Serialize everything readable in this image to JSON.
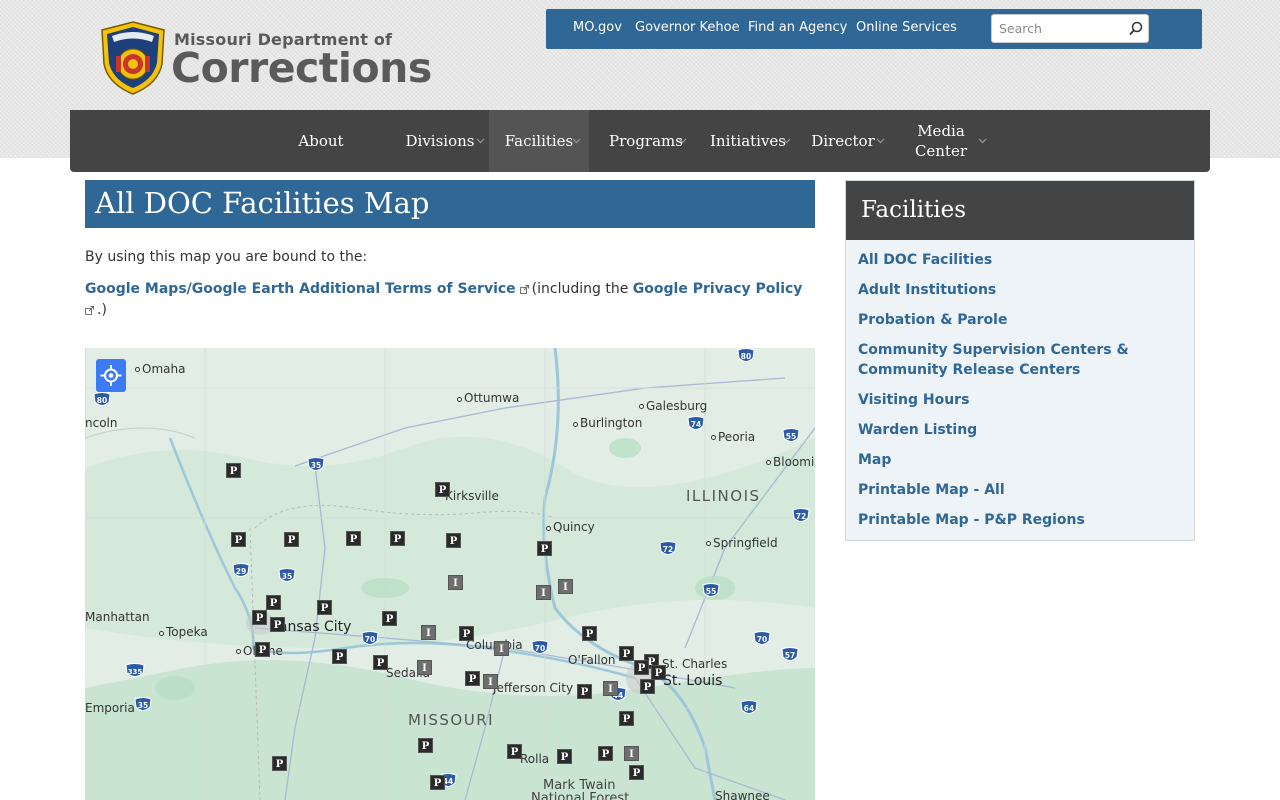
{
  "header": {
    "logo_line1": "Missouri Department of",
    "logo_line2": "Corrections"
  },
  "utility_nav": {
    "links": [
      "MO.gov",
      "Governor Kehoe",
      "Find an Agency",
      "Online Services"
    ],
    "search_placeholder": "Search"
  },
  "main_nav": {
    "items": [
      {
        "label": "About",
        "has_dropdown": false,
        "active": false
      },
      {
        "label": "Divisions",
        "has_dropdown": true,
        "active": false
      },
      {
        "label": "Facilities",
        "has_dropdown": true,
        "active": true
      },
      {
        "label": "Programs",
        "has_dropdown": true,
        "active": false
      },
      {
        "label": "Initiatives",
        "has_dropdown": true,
        "active": false
      },
      {
        "label": "Director",
        "has_dropdown": true,
        "active": false
      },
      {
        "label": "Media Center",
        "has_dropdown": true,
        "active": false
      }
    ]
  },
  "content": {
    "title": "All DOC Facilities Map",
    "intro": "By using this map you are bound to the:",
    "terms_link": "Google Maps/Google Earth Additional Terms of Service",
    "terms_mid": "(including the",
    "privacy_link": "Google Privacy Policy",
    "terms_end": ".)"
  },
  "map": {
    "cities": [
      "Omaha",
      "Ottumwa",
      "Galesburg",
      "Burlington",
      "Peoria",
      "Bloomin",
      "Kirksville",
      "Quincy",
      "Springfield",
      "Manhattan",
      "Topeka",
      "Olathe",
      "Columbia",
      "O'Fallon",
      "St. Charles",
      "St. Louis",
      "Sedalia",
      "Jefferson City",
      "Rolla",
      "Mark Twain",
      "National Forest",
      "Shawnee",
      "Emporia",
      "ncoln",
      "Kansas City"
    ],
    "states": [
      "ILLINOIS",
      "MISSOURI"
    ],
    "shields": [
      "80",
      "80",
      "74",
      "55",
      "35",
      "72",
      "72",
      "29",
      "35",
      "55",
      "70",
      "70",
      "70",
      "57",
      "335",
      "35",
      "64",
      "44",
      "44"
    ],
    "marker_letters": {
      "prison": "P",
      "institution": "I"
    }
  },
  "sidebar": {
    "title": "Facilities",
    "links": [
      "All DOC Facilities",
      "Adult Institutions",
      "Probation & Parole",
      "Community Supervision Centers & Community Release Centers",
      "Visiting Hours",
      "Warden Listing",
      "Map",
      "Printable Map - All",
      "Printable Map - P&P Regions"
    ]
  },
  "colors": {
    "brand_blue": "#2f6796",
    "nav_gray": "#444444",
    "map_green": "#cfe8d6",
    "map_bg": "#dfece4"
  }
}
